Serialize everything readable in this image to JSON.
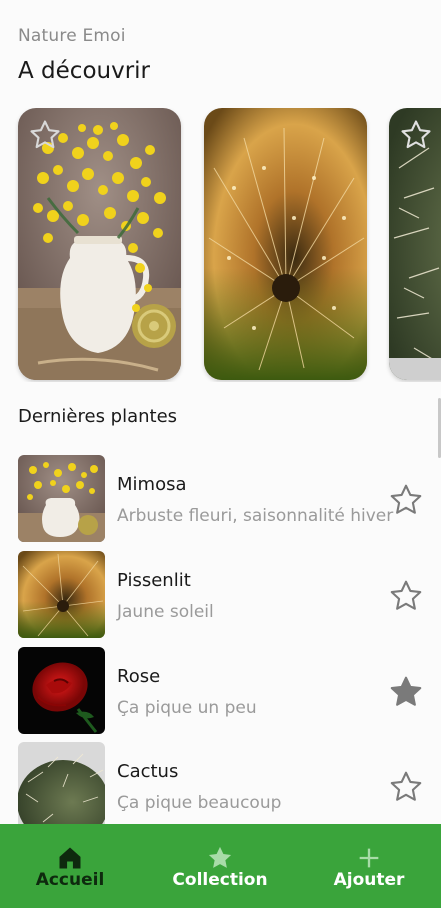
{
  "header": {
    "app_name": "Nature Emoi",
    "section_title": "A découvrir"
  },
  "discover": {
    "cards": [
      {
        "name": "Mimosa",
        "favorite": false,
        "star_icon": "star-outline-icon"
      },
      {
        "name": "Pissenlit",
        "favorite": false,
        "star_icon": "none"
      },
      {
        "name": "Cactus",
        "favorite": false,
        "star_icon": "star-outline-icon"
      }
    ]
  },
  "latest": {
    "title": "Dernières plantes",
    "items": [
      {
        "name": "Mimosa",
        "description": "Arbuste fleuri, saisonnalité hiver",
        "favorite": false
      },
      {
        "name": "Pissenlit",
        "description": "Jaune soleil",
        "favorite": false
      },
      {
        "name": "Rose",
        "description": "Ça pique un peu",
        "favorite": true
      },
      {
        "name": "Cactus",
        "description": "Ça pique beaucoup",
        "favorite": false
      }
    ]
  },
  "navbar": {
    "items": [
      {
        "label": "Accueil",
        "icon": "home-icon",
        "active": true
      },
      {
        "label": "Collection",
        "icon": "star-icon",
        "active": false
      },
      {
        "label": "Ajouter",
        "icon": "plus-icon",
        "active": false
      }
    ]
  },
  "colors": {
    "accent": "#3aa43b",
    "active_nav": "#0e2a0e",
    "star": "#7a7a7a"
  }
}
